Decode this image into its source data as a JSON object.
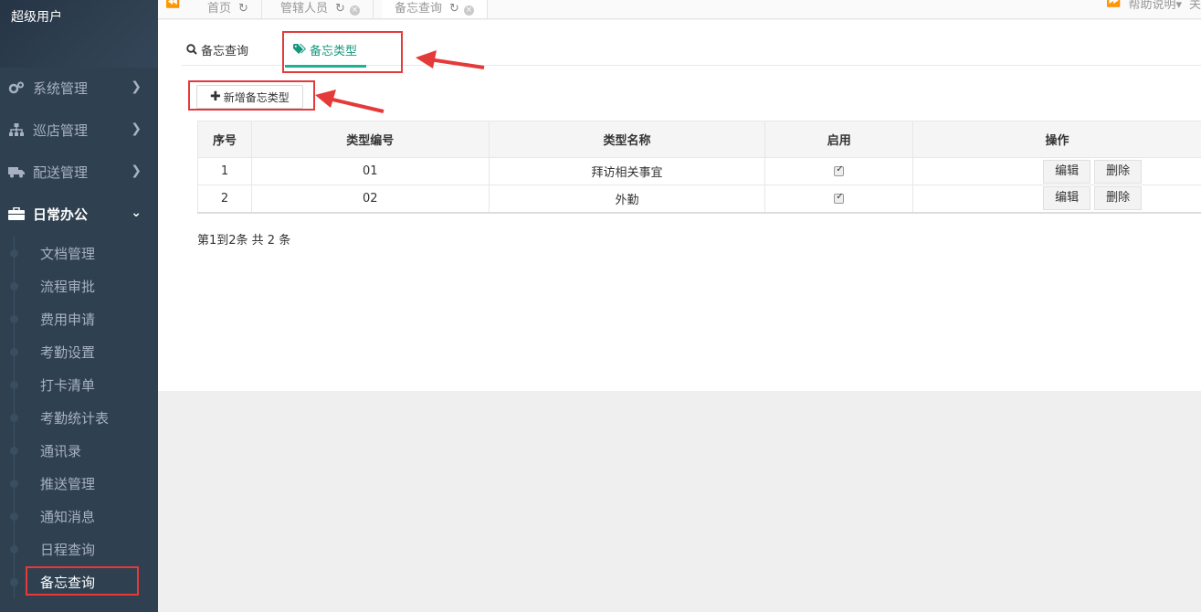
{
  "sidebar": {
    "user_name": "超级用户",
    "menu": [
      {
        "label": "系统管理",
        "icon": "gears-icon"
      },
      {
        "label": "巡店管理",
        "icon": "sitemap-icon"
      },
      {
        "label": "配送管理",
        "icon": "truck-icon"
      },
      {
        "label": "日常办公",
        "icon": "briefcase-icon"
      }
    ],
    "submenu": [
      "文档管理",
      "流程审批",
      "费用申请",
      "考勤设置",
      "打卡清单",
      "考勤统计表",
      "通讯录",
      "推送管理",
      "通知消息",
      "日程查询",
      "备忘查询"
    ]
  },
  "page_tabs": [
    {
      "label": "首页"
    },
    {
      "label": "管辖人员"
    },
    {
      "label": "备忘查询"
    }
  ],
  "top_right": {
    "help": "帮助说明",
    "more": "关"
  },
  "subtabs": {
    "query": "备忘查询",
    "types": "备忘类型"
  },
  "toolbar": {
    "add_label": "新增备忘类型"
  },
  "table": {
    "headers": [
      "序号",
      "类型编号",
      "类型名称",
      "启用",
      "操作"
    ],
    "rows": [
      {
        "no": "1",
        "code": "01",
        "name": "拜访相关事宜",
        "enabled": true
      },
      {
        "no": "2",
        "code": "02",
        "name": "外勤",
        "enabled": true
      }
    ],
    "edit_label": "编辑",
    "delete_label": "删除"
  },
  "pager": {
    "summary": "第1到2条 共 2 条"
  },
  "colors": {
    "sidebar_bg": "#2f4050",
    "accent": "#1ab394",
    "highlight": "#e43a3a"
  }
}
